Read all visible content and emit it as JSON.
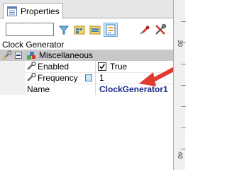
{
  "tabs": [
    {
      "label": "Properties",
      "icon": "properties-window-icon"
    }
  ],
  "toolbar": {
    "object_combo_value": "",
    "buttons": [
      {
        "name": "filter-icon"
      },
      {
        "name": "categorized-icon"
      },
      {
        "name": "alphabetical-icon"
      },
      {
        "name": "property-pages-icon"
      },
      {
        "name": "pin-icon"
      },
      {
        "name": "tools-icon"
      }
    ]
  },
  "object_name": "Clock Generator",
  "grid": {
    "category": {
      "label": "Miscellaneous",
      "expanded": true
    },
    "rows": [
      {
        "name": "Enabled",
        "value": "True",
        "checked": true
      },
      {
        "name": "Frequency",
        "value": "1"
      },
      {
        "name": "Name",
        "value": "ClockGenerator1"
      }
    ]
  },
  "ruler": {
    "labels": [
      "30",
      "40"
    ]
  },
  "colors": {
    "accent": "#e03a33",
    "value_bold": "#1a2b8a",
    "category_band": "#c8c8c8"
  }
}
